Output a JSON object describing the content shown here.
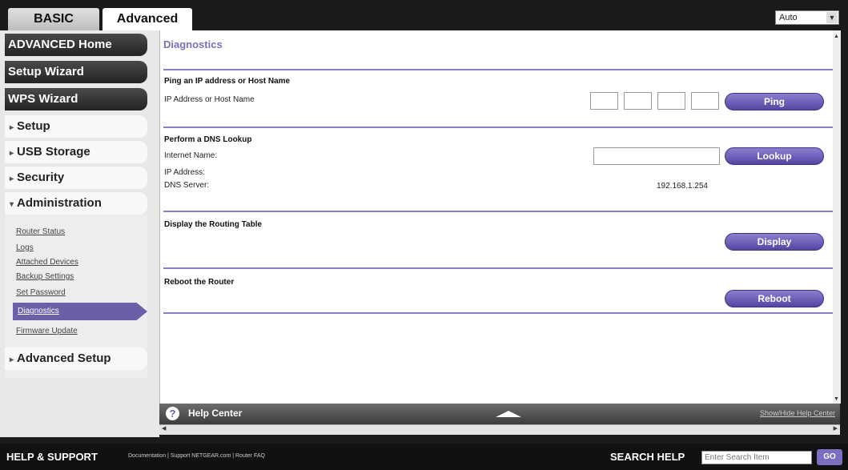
{
  "tabs": {
    "basic": "BASIC",
    "advanced": "Advanced"
  },
  "language_select": {
    "value": "Auto"
  },
  "sidebar": {
    "advanced_home": "ADVANCED Home",
    "setup_wizard": "Setup Wizard",
    "wps_wizard": "WPS Wizard",
    "setup": "Setup",
    "usb_storage": "USB Storage",
    "security": "Security",
    "administration": "Administration",
    "admin_links": [
      "Router Status",
      "Logs",
      "Attached Devices",
      "Backup Settings",
      "Set Password",
      "Diagnostics",
      "Firmware Update"
    ],
    "advanced_setup": "Advanced Setup"
  },
  "main": {
    "title": "Diagnostics",
    "ping": {
      "heading": "Ping an IP address or Host Name",
      "label": "IP Address or Host Name",
      "button": "Ping"
    },
    "dns": {
      "heading": "Perform a DNS Lookup",
      "internet_name_label": "Internet Name:",
      "ip_label": "IP Address:",
      "dns_server_label": "DNS Server:",
      "dns_server_value": "192.168.1.254",
      "button": "Lookup"
    },
    "routing": {
      "heading": "Display the Routing Table",
      "button": "Display"
    },
    "reboot": {
      "heading": "Reboot the Router",
      "button": "Reboot"
    }
  },
  "help_center": {
    "title": "Help Center",
    "toggle": "Show/Hide Help Center"
  },
  "footer": {
    "title": "HELP & SUPPORT",
    "links": [
      "Documentation",
      "Support NETGEAR.com",
      "Router FAQ"
    ],
    "search_label": "SEARCH HELP",
    "search_placeholder": "Enter Search Item",
    "go": "GO"
  },
  "colors": {
    "accent": "#6d5ea8",
    "title": "#7b6fb5"
  }
}
